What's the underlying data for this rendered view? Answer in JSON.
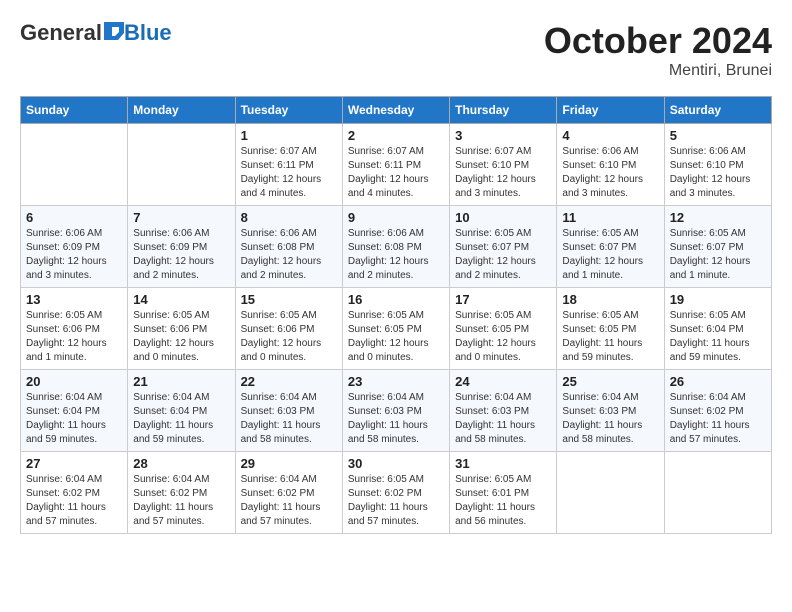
{
  "header": {
    "logo_general": "General",
    "logo_blue": "Blue",
    "month_title": "October 2024",
    "location": "Mentiri, Brunei"
  },
  "days_of_week": [
    "Sunday",
    "Monday",
    "Tuesday",
    "Wednesday",
    "Thursday",
    "Friday",
    "Saturday"
  ],
  "weeks": [
    [
      {
        "day": "",
        "info": ""
      },
      {
        "day": "",
        "info": ""
      },
      {
        "day": "1",
        "info": "Sunrise: 6:07 AM\nSunset: 6:11 PM\nDaylight: 12 hours and 4 minutes."
      },
      {
        "day": "2",
        "info": "Sunrise: 6:07 AM\nSunset: 6:11 PM\nDaylight: 12 hours and 4 minutes."
      },
      {
        "day": "3",
        "info": "Sunrise: 6:07 AM\nSunset: 6:10 PM\nDaylight: 12 hours and 3 minutes."
      },
      {
        "day": "4",
        "info": "Sunrise: 6:06 AM\nSunset: 6:10 PM\nDaylight: 12 hours and 3 minutes."
      },
      {
        "day": "5",
        "info": "Sunrise: 6:06 AM\nSunset: 6:10 PM\nDaylight: 12 hours and 3 minutes."
      }
    ],
    [
      {
        "day": "6",
        "info": "Sunrise: 6:06 AM\nSunset: 6:09 PM\nDaylight: 12 hours and 3 minutes."
      },
      {
        "day": "7",
        "info": "Sunrise: 6:06 AM\nSunset: 6:09 PM\nDaylight: 12 hours and 2 minutes."
      },
      {
        "day": "8",
        "info": "Sunrise: 6:06 AM\nSunset: 6:08 PM\nDaylight: 12 hours and 2 minutes."
      },
      {
        "day": "9",
        "info": "Sunrise: 6:06 AM\nSunset: 6:08 PM\nDaylight: 12 hours and 2 minutes."
      },
      {
        "day": "10",
        "info": "Sunrise: 6:05 AM\nSunset: 6:07 PM\nDaylight: 12 hours and 2 minutes."
      },
      {
        "day": "11",
        "info": "Sunrise: 6:05 AM\nSunset: 6:07 PM\nDaylight: 12 hours and 1 minute."
      },
      {
        "day": "12",
        "info": "Sunrise: 6:05 AM\nSunset: 6:07 PM\nDaylight: 12 hours and 1 minute."
      }
    ],
    [
      {
        "day": "13",
        "info": "Sunrise: 6:05 AM\nSunset: 6:06 PM\nDaylight: 12 hours and 1 minute."
      },
      {
        "day": "14",
        "info": "Sunrise: 6:05 AM\nSunset: 6:06 PM\nDaylight: 12 hours and 0 minutes."
      },
      {
        "day": "15",
        "info": "Sunrise: 6:05 AM\nSunset: 6:06 PM\nDaylight: 12 hours and 0 minutes."
      },
      {
        "day": "16",
        "info": "Sunrise: 6:05 AM\nSunset: 6:05 PM\nDaylight: 12 hours and 0 minutes."
      },
      {
        "day": "17",
        "info": "Sunrise: 6:05 AM\nSunset: 6:05 PM\nDaylight: 12 hours and 0 minutes."
      },
      {
        "day": "18",
        "info": "Sunrise: 6:05 AM\nSunset: 6:05 PM\nDaylight: 11 hours and 59 minutes."
      },
      {
        "day": "19",
        "info": "Sunrise: 6:05 AM\nSunset: 6:04 PM\nDaylight: 11 hours and 59 minutes."
      }
    ],
    [
      {
        "day": "20",
        "info": "Sunrise: 6:04 AM\nSunset: 6:04 PM\nDaylight: 11 hours and 59 minutes."
      },
      {
        "day": "21",
        "info": "Sunrise: 6:04 AM\nSunset: 6:04 PM\nDaylight: 11 hours and 59 minutes."
      },
      {
        "day": "22",
        "info": "Sunrise: 6:04 AM\nSunset: 6:03 PM\nDaylight: 11 hours and 58 minutes."
      },
      {
        "day": "23",
        "info": "Sunrise: 6:04 AM\nSunset: 6:03 PM\nDaylight: 11 hours and 58 minutes."
      },
      {
        "day": "24",
        "info": "Sunrise: 6:04 AM\nSunset: 6:03 PM\nDaylight: 11 hours and 58 minutes."
      },
      {
        "day": "25",
        "info": "Sunrise: 6:04 AM\nSunset: 6:03 PM\nDaylight: 11 hours and 58 minutes."
      },
      {
        "day": "26",
        "info": "Sunrise: 6:04 AM\nSunset: 6:02 PM\nDaylight: 11 hours and 57 minutes."
      }
    ],
    [
      {
        "day": "27",
        "info": "Sunrise: 6:04 AM\nSunset: 6:02 PM\nDaylight: 11 hours and 57 minutes."
      },
      {
        "day": "28",
        "info": "Sunrise: 6:04 AM\nSunset: 6:02 PM\nDaylight: 11 hours and 57 minutes."
      },
      {
        "day": "29",
        "info": "Sunrise: 6:04 AM\nSunset: 6:02 PM\nDaylight: 11 hours and 57 minutes."
      },
      {
        "day": "30",
        "info": "Sunrise: 6:05 AM\nSunset: 6:02 PM\nDaylight: 11 hours and 57 minutes."
      },
      {
        "day": "31",
        "info": "Sunrise: 6:05 AM\nSunset: 6:01 PM\nDaylight: 11 hours and 56 minutes."
      },
      {
        "day": "",
        "info": ""
      },
      {
        "day": "",
        "info": ""
      }
    ]
  ]
}
